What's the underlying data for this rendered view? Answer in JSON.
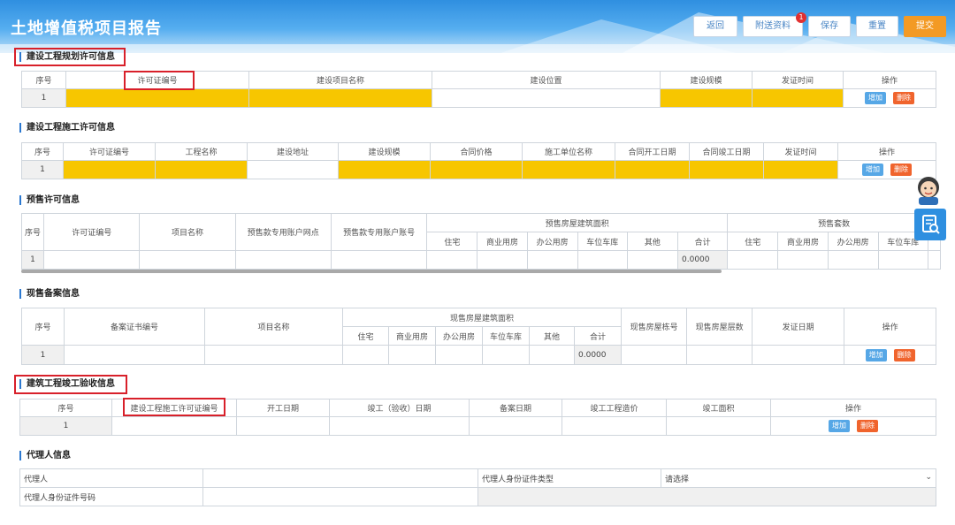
{
  "header": {
    "title": "土地增值税项目报告",
    "buttons": [
      "返回",
      "附送资料",
      "保存",
      "重置",
      "提交"
    ],
    "badge_count": "1",
    "accent_color": "#f39a24"
  },
  "actions": {
    "add": "增加",
    "delete": "删除"
  },
  "s1": {
    "title": "建设工程规划许可信息",
    "headers": [
      "序号",
      "许可证编号",
      "建设项目名称",
      "建设位置",
      "建设规模",
      "发证时间",
      "操作"
    ],
    "row_index": "1"
  },
  "s2": {
    "title": "建设工程施工许可信息",
    "headers": [
      "序号",
      "许可证编号",
      "工程名称",
      "建设地址",
      "建设规模",
      "合同价格",
      "施工单位名称",
      "合同开工日期",
      "合同竣工日期",
      "发证时间",
      "操作"
    ],
    "row_index": "1"
  },
  "s3": {
    "title": "预售许可信息",
    "headers": [
      "序号",
      "许可证编号",
      "项目名称",
      "预售款专用账户网点",
      "预售款专用账户账号"
    ],
    "group1": "预售房屋建筑面积",
    "group2": "预售套数",
    "sub1": [
      "住宅",
      "商业用房",
      "办公用房",
      "车位车库",
      "其他",
      "合计"
    ],
    "sub2": [
      "住宅",
      "商业用房",
      "办公用房",
      "车位车库"
    ],
    "row_index": "1",
    "total": "0.0000"
  },
  "s4": {
    "title": "现售备案信息",
    "headers": [
      "序号",
      "备案证书编号",
      "项目名称"
    ],
    "group": "现售房屋建筑面积",
    "sub": [
      "住宅",
      "商业用房",
      "办公用房",
      "车位车库",
      "其他",
      "合计"
    ],
    "tail": [
      "现售房屋栋号",
      "现售房屋层数",
      "发证日期",
      "操作"
    ],
    "row_index": "1",
    "total": "0.0000"
  },
  "s5": {
    "title": "建筑工程竣工验收信息",
    "headers": [
      "序号",
      "建设工程施工许可证编号",
      "开工日期",
      "竣工（验收）日期",
      "备案日期",
      "竣工工程造价",
      "竣工面积",
      "操作"
    ],
    "row_index": "1"
  },
  "s6": {
    "title": "代理人信息",
    "agent_label": "代理人",
    "id_type_label": "代理人身份证件类型",
    "id_type_value": "请选择",
    "id_number_label": "代理人身份证件号码"
  }
}
